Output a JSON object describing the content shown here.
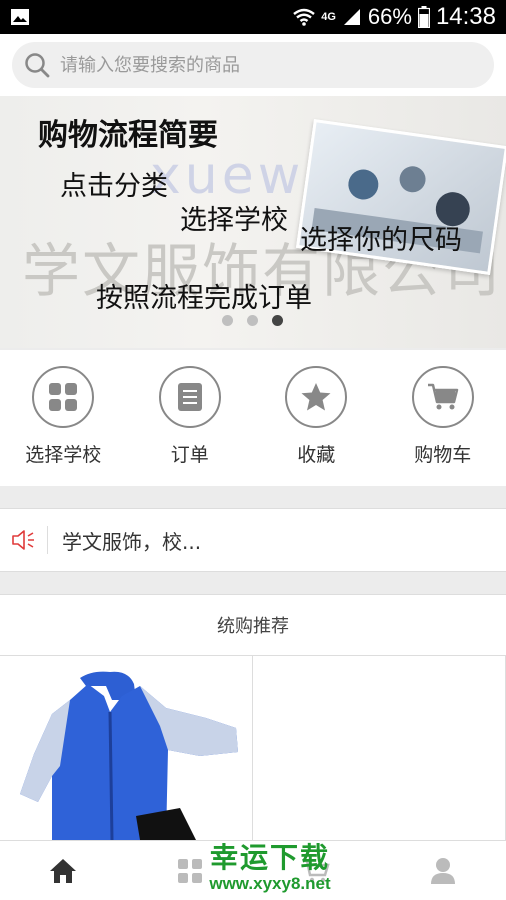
{
  "status_bar": {
    "network_label": "4G",
    "battery": "66%",
    "time": "14:38"
  },
  "search": {
    "placeholder": "请输入您要搜索的商品",
    "icon": "search-icon"
  },
  "banner": {
    "title": "购物流程简要",
    "steps": [
      "点击分类",
      "选择学校",
      "选择你的尺码",
      "按照流程完成订单"
    ],
    "logo_text": "xuew",
    "background_text": "学文服饰有限公司",
    "active_slide": 3,
    "slide_count": 3
  },
  "quick_nav": [
    {
      "label": "选择学校",
      "icon": "grid-icon"
    },
    {
      "label": "订单",
      "icon": "document-icon"
    },
    {
      "label": "收藏",
      "icon": "star-icon"
    },
    {
      "label": "购物车",
      "icon": "cart-icon"
    }
  ],
  "notice": {
    "icon": "speaker-icon",
    "text": "学文服饰，校..."
  },
  "recommend": {
    "title": "统购推荐"
  },
  "tab_bar": [
    {
      "icon": "home-icon"
    },
    {
      "icon": "category-icon"
    },
    {
      "icon": "cart-icon"
    },
    {
      "icon": "user-icon"
    }
  ],
  "overlay_watermark": {
    "line1": "幸运下载",
    "line2": "www.xyxy8.net"
  },
  "colors": {
    "accent_red": "#e03b3b",
    "watermark_green": "#1f9a2e"
  }
}
